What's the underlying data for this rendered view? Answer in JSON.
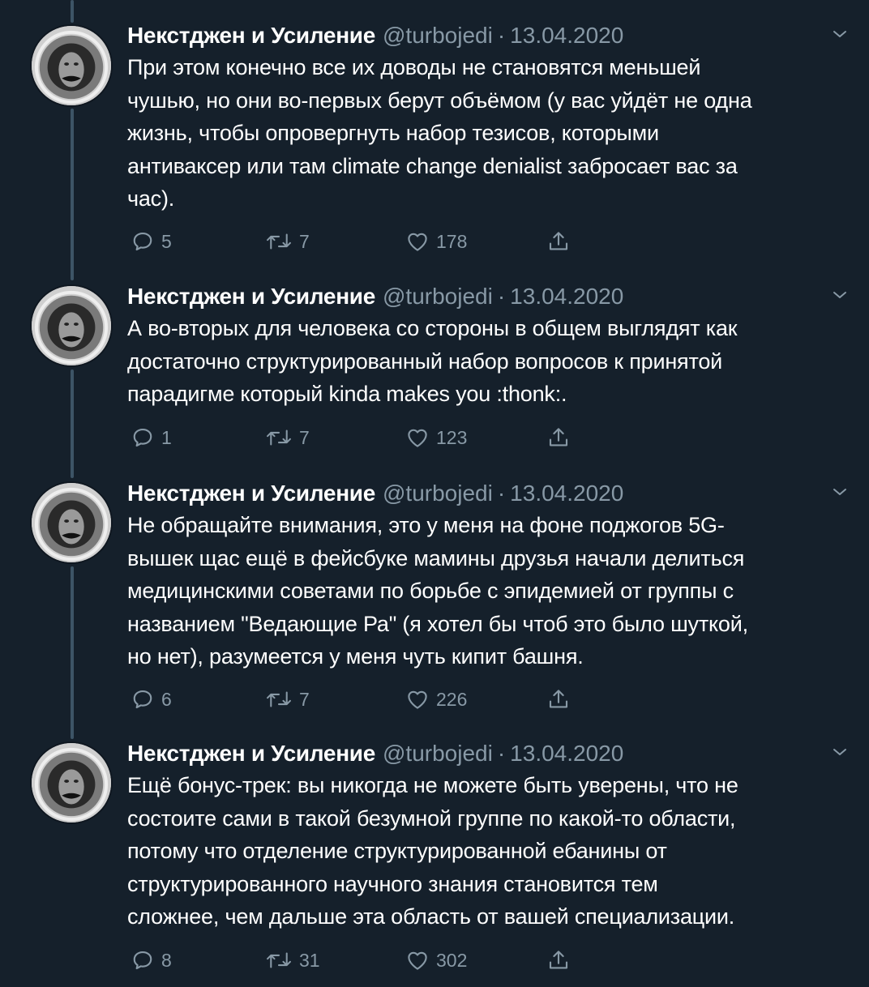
{
  "tweets": [
    {
      "name": "Некстджен и Усиление",
      "handle": "@turbojedi",
      "separator": "·",
      "date": "13.04.2020",
      "text": "При этом конечно все их доводы не становятся меньшей\nчушью, но они во-первых берут объёмом (у вас уйдёт не одна\nжизнь, чтобы опровергнуть набор тезисов, которыми\nантиваксер или там climate change denialist забросает вас за\nчас).",
      "replies": "5",
      "retweets": "7",
      "likes": "178"
    },
    {
      "name": "Некстджен и Усиление",
      "handle": "@turbojedi",
      "separator": "·",
      "date": "13.04.2020",
      "text": "А во-вторых для человека со стороны в общем выглядят как\nдостаточно структурированный набор вопросов к принятой\nпарадигме который kinda makes you :thonk:.",
      "replies": "1",
      "retweets": "7",
      "likes": "123"
    },
    {
      "name": "Некстджен и Усиление",
      "handle": "@turbojedi",
      "separator": "·",
      "date": "13.04.2020",
      "text": "Не обращайте внимания, это у меня на фоне поджогов 5G-\nвышек щас ещё в фейсбуке мамины друзья начали делиться\nмедицинскими советами по борьбе с эпидемией от группы с\nназванием \"Ведающие Ра\" (я хотел бы чтоб это было шуткой,\nно нет), разумеется у меня чуть кипит башня.",
      "replies": "6",
      "retweets": "7",
      "likes": "226"
    },
    {
      "name": "Некстджен и Усиление",
      "handle": "@turbojedi",
      "separator": "·",
      "date": "13.04.2020",
      "text": "Ещё бонус-трек: вы никогда не можете быть уверены, что не\nсостоите сами в такой безумной группе по какой-то области,\nпотому что отделение структурированной ебанины от\nструктурированного научного знания становится тем\nсложнее, чем дальше эта область от вашей специализации.",
      "replies": "8",
      "retweets": "31",
      "likes": "302"
    }
  ],
  "colors": {
    "background": "#15202b",
    "secondary_text": "#8899a6",
    "thread_line": "#3d5466"
  },
  "icons": [
    "reply-icon",
    "retweet-icon",
    "like-icon",
    "share-icon",
    "chevron-down-icon",
    "avatar"
  ]
}
